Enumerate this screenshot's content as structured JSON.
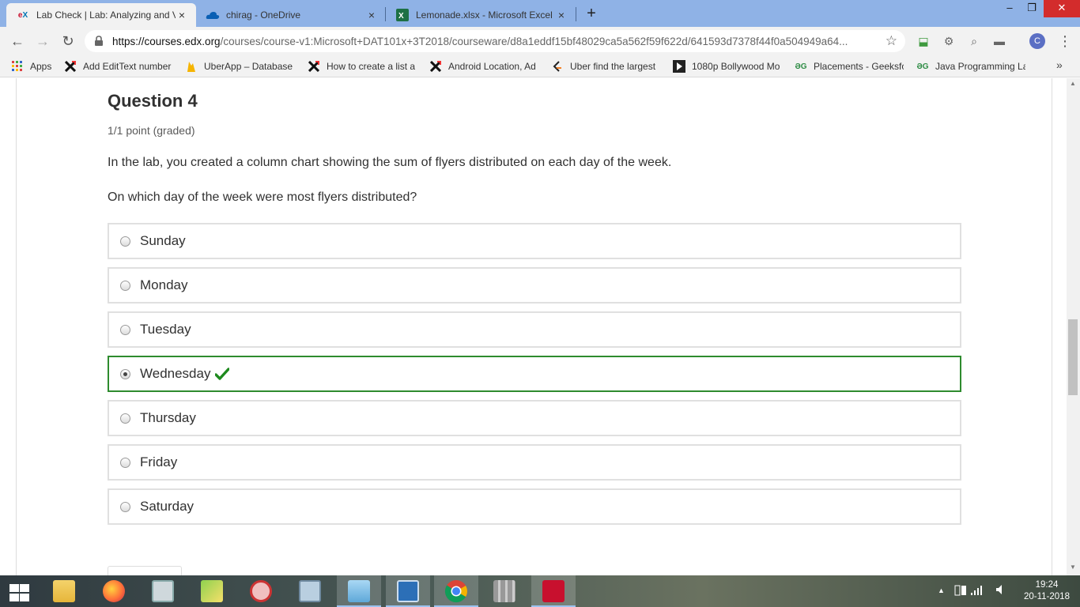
{
  "browser": {
    "tabs": [
      {
        "label": "Lab Check | Lab: Analyzing and V",
        "icon": "edx-icon",
        "active": true
      },
      {
        "label": "chirag - OneDrive",
        "icon": "onedrive-icon",
        "active": false
      },
      {
        "label": "Lemonade.xlsx - Microsoft Excel",
        "icon": "excel-icon",
        "active": false
      }
    ],
    "new_tab_symbol": "+",
    "window_controls": {
      "minimize": "–",
      "maximize": "❐",
      "close": "✕"
    },
    "url_host": "https://courses.edx.org",
    "url_path": "/courses/course-v1:Microsoft+DAT101x+3T2018/courseware/d8a1eddf15bf48029ca5a562f59f622d/641593d7378f44f0a504949a64...",
    "profile_initial": "C"
  },
  "bookmarks": [
    {
      "label": "Apps",
      "icon": "apps-grid-icon"
    },
    {
      "label": "Add EditText number",
      "icon": "x-logo-icon"
    },
    {
      "label": "UberApp – Database",
      "icon": "firebase-icon"
    },
    {
      "label": "How to create a list a",
      "icon": "x-logo-icon"
    },
    {
      "label": "Android Location, Ad",
      "icon": "x-logo-icon"
    },
    {
      "label": "Uber find the largest",
      "icon": "code-icon"
    },
    {
      "label": "1080p Bollywood Mo",
      "icon": "play-icon"
    },
    {
      "label": "Placements - Geeksfo",
      "icon": "geeksforgeeks-icon"
    },
    {
      "label": "Java Programming La",
      "icon": "geeksforgeeks-icon"
    }
  ],
  "question": {
    "title": "Question 4",
    "points": "1/1 point (graded)",
    "text": "In the lab, you created a column chart showing the sum of flyers distributed on each day of the week.",
    "prompt": "On which day of the week were most flyers distributed?",
    "options": [
      {
        "label": "Sunday",
        "selected": false,
        "correct": false
      },
      {
        "label": "Monday",
        "selected": false,
        "correct": false
      },
      {
        "label": "Tuesday",
        "selected": false,
        "correct": false
      },
      {
        "label": "Wednesday",
        "selected": true,
        "correct": true
      },
      {
        "label": "Thursday",
        "selected": false,
        "correct": false
      },
      {
        "label": "Friday",
        "selected": false,
        "correct": false
      },
      {
        "label": "Saturday",
        "selected": false,
        "correct": false
      }
    ]
  },
  "taskbar": {
    "apps": [
      "file-explorer-icon",
      "firefox-icon",
      "task-manager-icon",
      "folders-icon",
      "snipping-tool-icon",
      "calculator-icon",
      "notepad-icon",
      "control-panel-icon",
      "chrome-icon",
      "photos-icon",
      "acrobat-icon"
    ],
    "active_app": "chrome-icon",
    "time": "19:24",
    "date": "20-11-2018"
  },
  "colors": {
    "correct_border": "#2e8b2e",
    "checkmark": "#1e8a1e",
    "tab_bar": "#8fb2e6"
  }
}
